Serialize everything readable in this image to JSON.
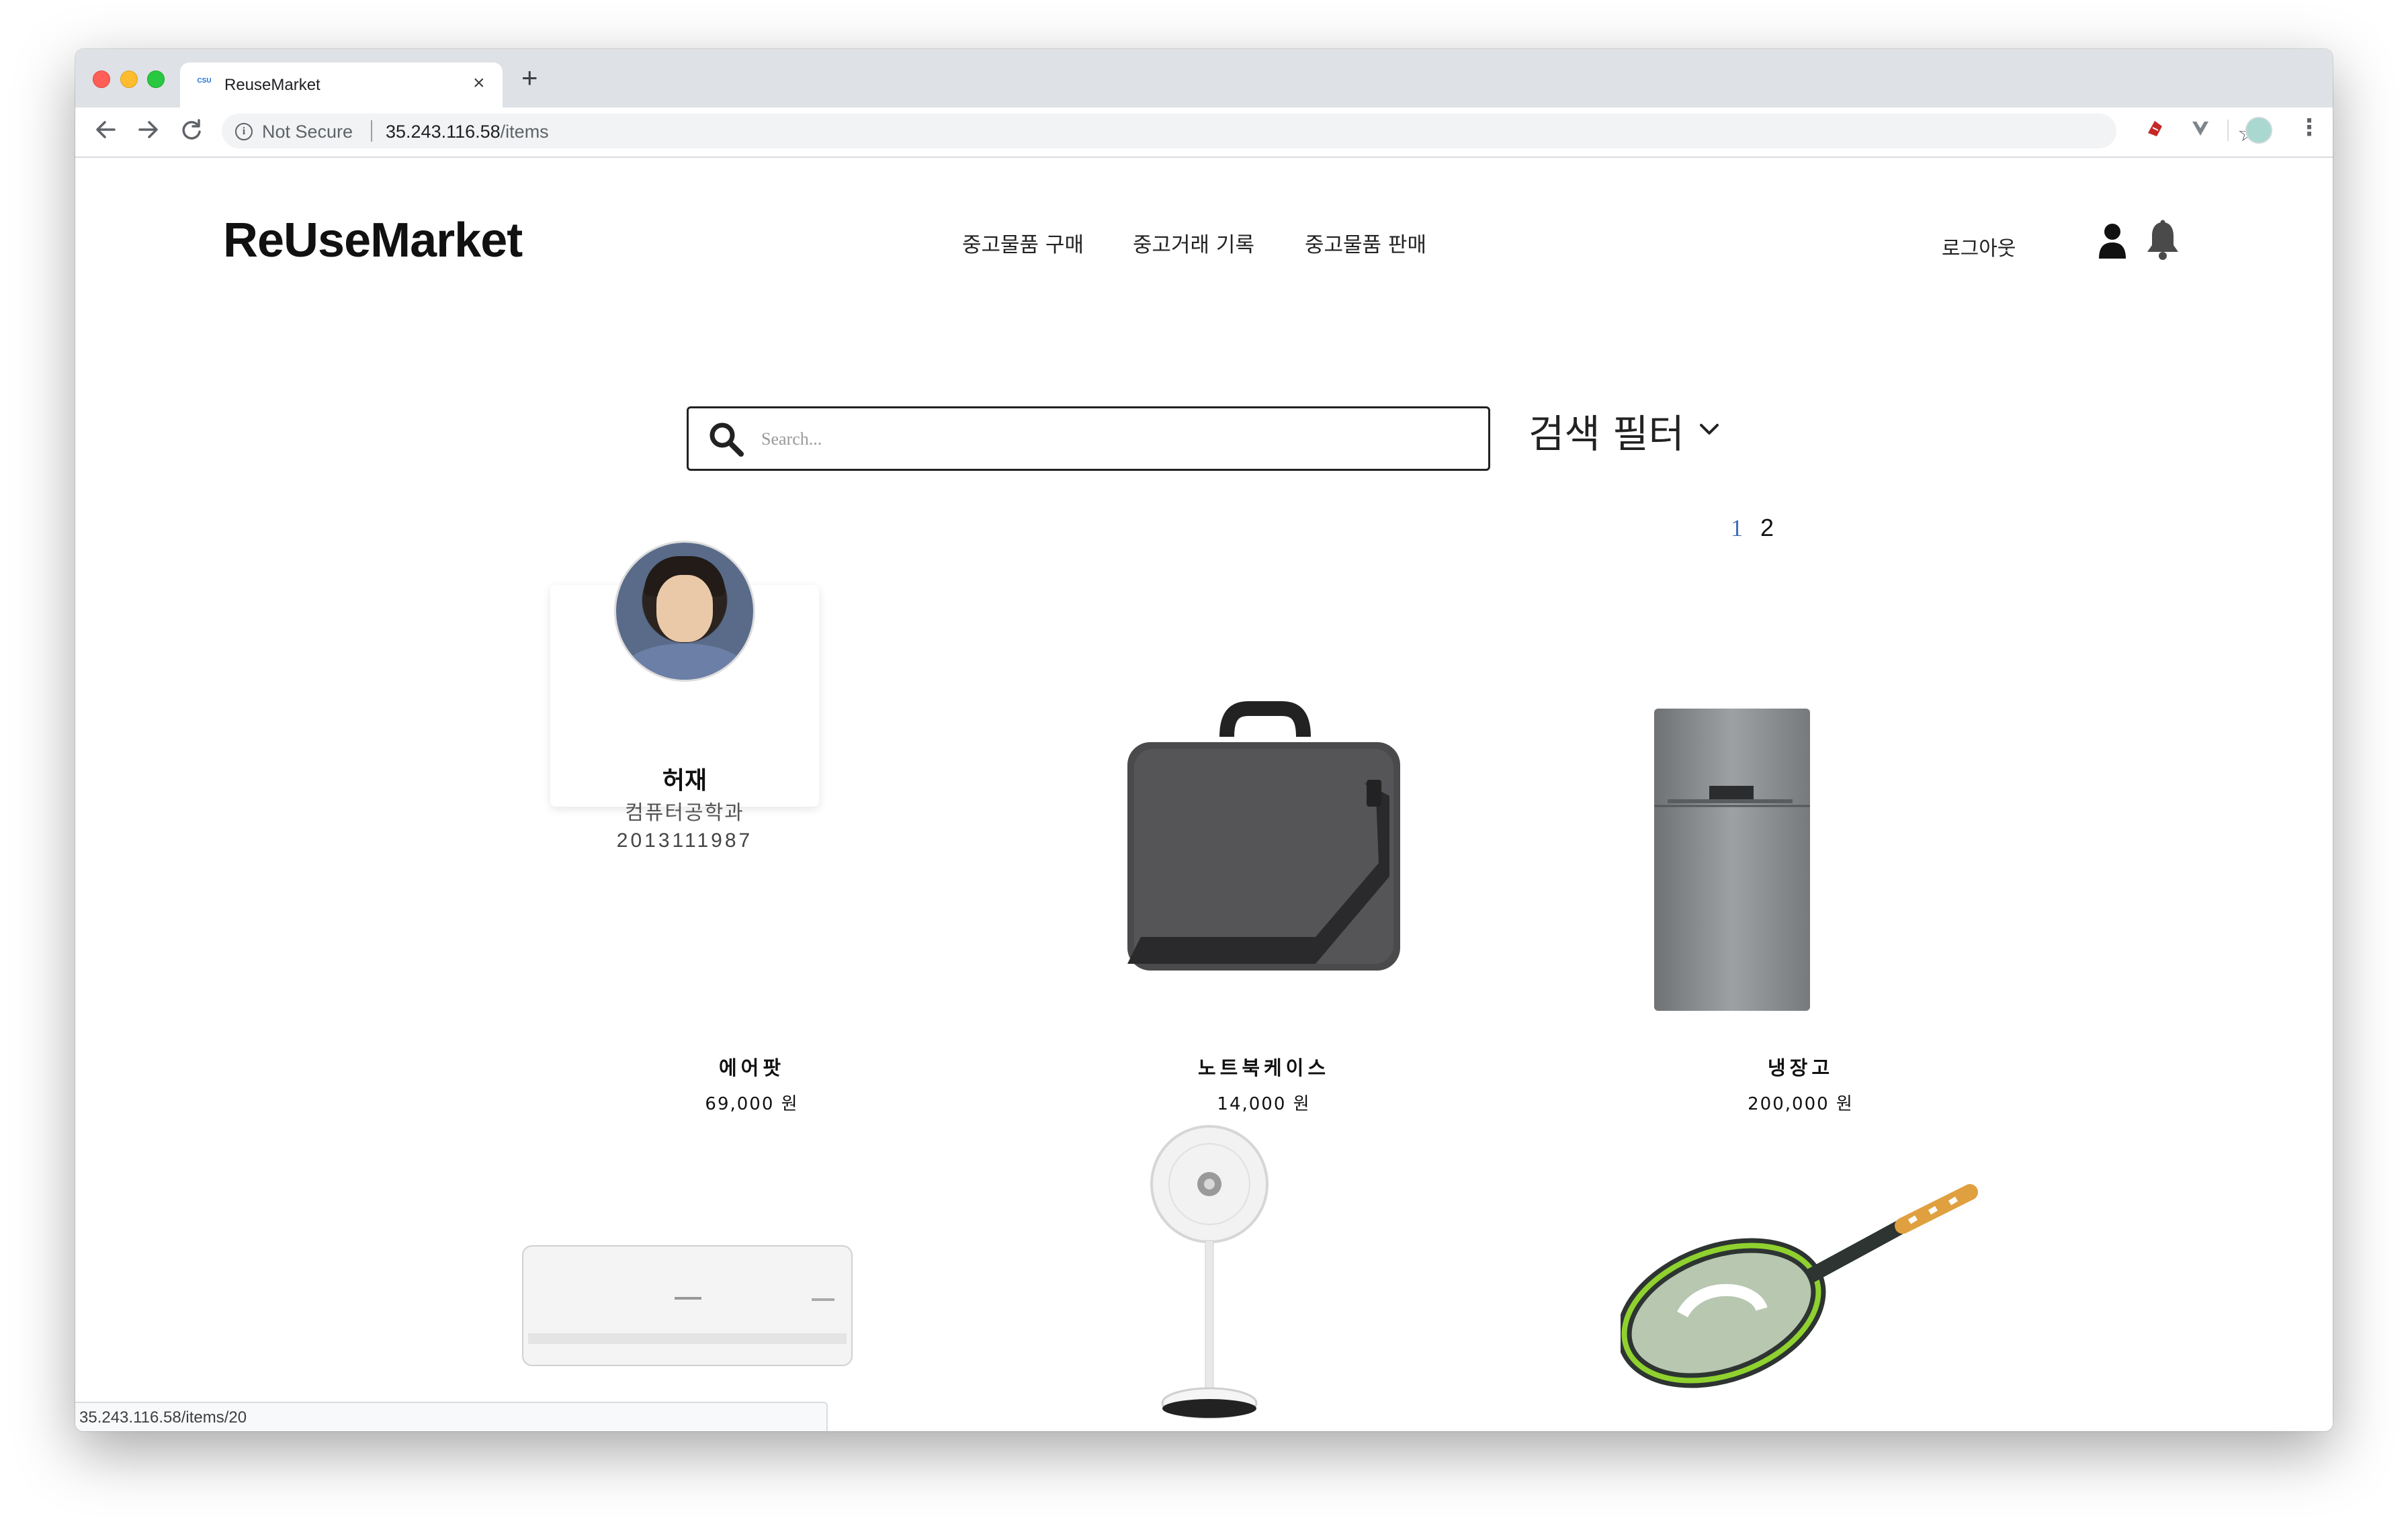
{
  "browser": {
    "tab_title": "ReuseMarket",
    "favicon_text": "CSU",
    "new_tab_label": "+",
    "close_tab_label": "×",
    "security_label": "Not Secure",
    "url_host": "35.243.116.58",
    "url_path": "/items",
    "status_url": "35.243.116.58/items/20"
  },
  "header": {
    "logo": "ReUseMarket",
    "nav": [
      "중고물품 구매",
      "중고거래 기록",
      "중고물품 판매"
    ],
    "logout": "로그아웃"
  },
  "search": {
    "placeholder": "Search...",
    "filter_label": "검색 필터"
  },
  "pagination": [
    "1",
    "2"
  ],
  "profile": {
    "name": "허재",
    "department": "컴퓨터공학과",
    "student_id": "2013111987"
  },
  "items": [
    {
      "name": "에어팟",
      "price": "69,000 원"
    },
    {
      "name": "노트북케이스",
      "price": "14,000 원"
    },
    {
      "name": "냉장고",
      "price": "200,000 원"
    }
  ],
  "colors": {
    "pager_active": "#3f6fb5",
    "tabstrip": "#dee1e6",
    "text": "#111111"
  }
}
